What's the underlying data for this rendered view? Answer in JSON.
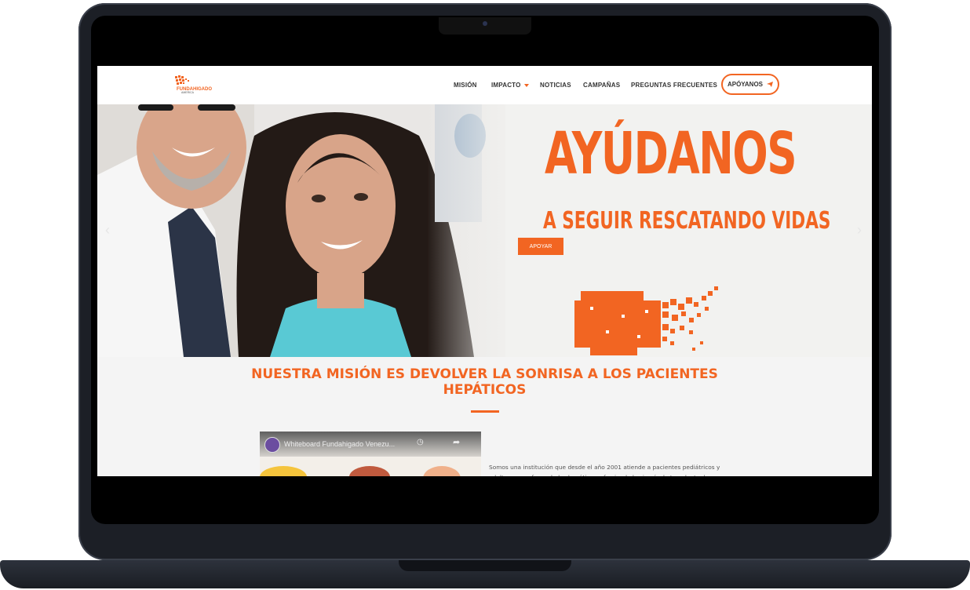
{
  "site": {
    "logo_text": "FUNDAHIGADO AMERICA",
    "nav": {
      "items": [
        {
          "label": "MISIÓN"
        },
        {
          "label": "IMPACTO"
        },
        {
          "label": "NOTICIAS"
        },
        {
          "label": "CAMPAÑAS"
        },
        {
          "label": "PREGUNTAS FRECUENTES"
        }
      ],
      "cta_label": "APÓYANOS"
    },
    "hero": {
      "headline": "AYÚDANOS",
      "subheadline": "A SEGUIR RESCATANDO VIDAS",
      "button_label": "APOYAR",
      "prev_arrow": "‹",
      "next_arrow": "›"
    },
    "mission": {
      "title_line1": "NUESTRA MISIÓN ES DEVOLVER LA SONRISA A LOS PACIENTES",
      "title_line2": "HEPÁTICOS"
    },
    "video": {
      "title": "Whiteboard Fundahigado Venezu...",
      "watch_icon": "clock-icon",
      "share_icon": "share-icon"
    },
    "about_text": "Somos una institución que desde el año 2001 atiende a pacientes pediátricos y adultos con enfermedades hepáticas, ofreciendo la cirugía de trasplante de"
  },
  "colors": {
    "accent": "#f26522",
    "frame": "#1c1f26"
  }
}
